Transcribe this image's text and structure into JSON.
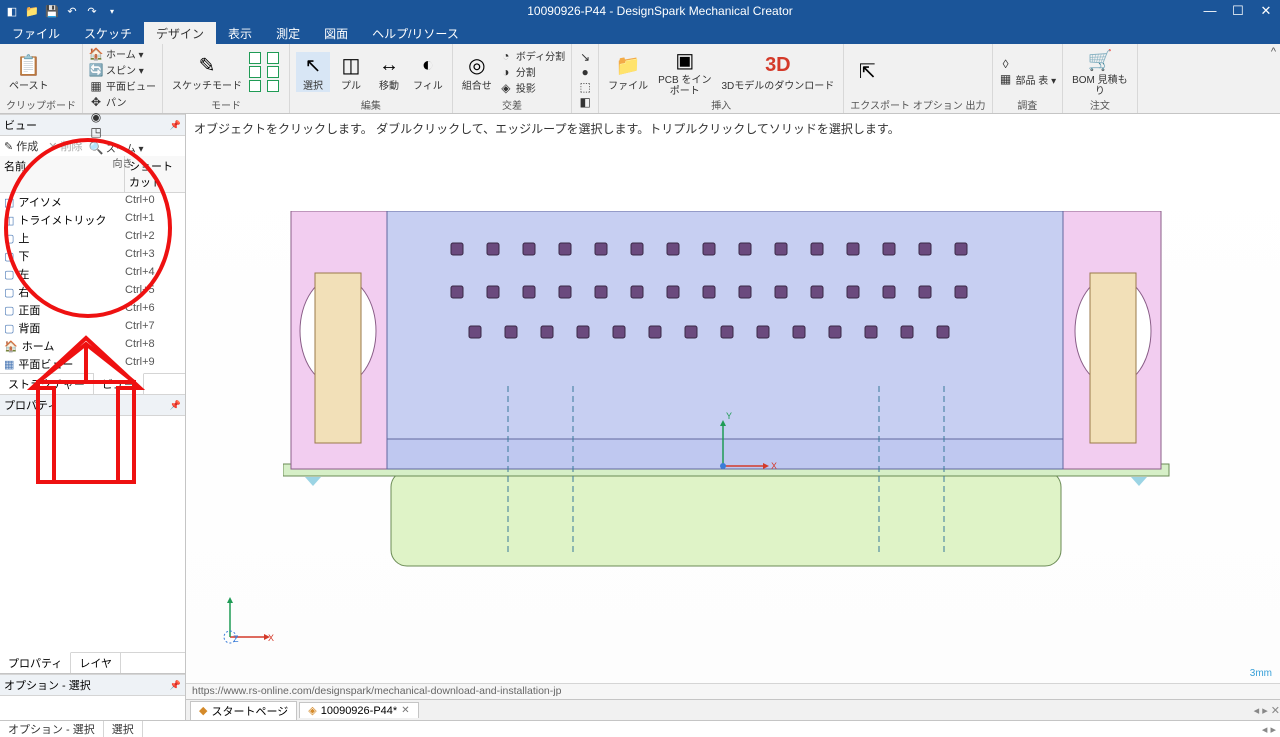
{
  "title": "10090926-P44 - DesignSpark Mechanical Creator",
  "menus": [
    "ファイル",
    "スケッチ",
    "デザイン",
    "表示",
    "測定",
    "図面",
    "ヘルプ/リソース"
  ],
  "active_menu": 2,
  "ribbon": {
    "groups": [
      {
        "label": "クリップボード",
        "big": [
          {
            "l": "ペースト",
            "i": "📋"
          }
        ],
        "small": []
      },
      {
        "label": "向き",
        "big": [],
        "small": [
          [
            "🏠",
            "ホーム ▾"
          ],
          [
            "🔄",
            "スピン ▾"
          ],
          [
            "▦",
            "平面ビュー"
          ],
          [
            "✥",
            "パン"
          ],
          [
            "◉",
            ""
          ],
          [
            "◳",
            ""
          ],
          [
            "🔍",
            "ズーム ▾"
          ]
        ]
      },
      {
        "label": "モード",
        "big": [
          {
            "l": "スケッチモード",
            "i": "✎"
          }
        ],
        "cubes": true
      },
      {
        "label": "編集",
        "big": [
          {
            "l": "選択",
            "i": "↖",
            "sel": true
          },
          {
            "l": "プル",
            "i": "◫"
          },
          {
            "l": "移動",
            "i": "↔"
          },
          {
            "l": "フィル",
            "i": "◐"
          }
        ]
      },
      {
        "label": "交差",
        "big": [
          {
            "l": "組合せ",
            "i": "◎"
          }
        ],
        "small": [
          [
            "◔",
            "ボディ分割"
          ],
          [
            "◑",
            "分割"
          ],
          [
            "◈",
            "投影"
          ]
        ]
      },
      {
        "label": "",
        "big": [],
        "small": [
          [
            "↘",
            ""
          ],
          [
            "●",
            ""
          ],
          [
            "⬚",
            ""
          ],
          [
            "◧",
            ""
          ]
        ],
        "nolabel": true
      },
      {
        "label": "挿入",
        "big": [
          {
            "l": "ファイル",
            "i": "📁"
          },
          {
            "l": "PCB をイン\nポート",
            "i": "▣"
          },
          {
            "l": "3Dモデルのダウンロード",
            "i": "3D",
            "red": true
          }
        ]
      },
      {
        "label": "エクスポート\nオプション\n出力",
        "big": [
          {
            "l": "",
            "i": "⇱"
          }
        ]
      },
      {
        "label": "調査",
        "big": [],
        "small": [
          [
            "◊",
            ""
          ],
          [
            "▦",
            "部品\n表 ▾"
          ]
        ]
      },
      {
        "label": "注文",
        "big": [
          {
            "l": "BOM 見積も\nり",
            "i": "🛒"
          }
        ]
      }
    ]
  },
  "panels": {
    "view_title": "ビュー",
    "create": "作成",
    "delete": "削除",
    "col_name": "名前",
    "col_shortcut": "ショートカット",
    "views": [
      {
        "n": "アイソメ",
        "s": "Ctrl+0",
        "i": "◫"
      },
      {
        "n": "トライメトリック",
        "s": "Ctrl+1",
        "i": "◫"
      },
      {
        "n": "上",
        "s": "Ctrl+2",
        "i": "▢"
      },
      {
        "n": "下",
        "s": "Ctrl+3",
        "i": "▢"
      },
      {
        "n": "左",
        "s": "Ctrl+4",
        "i": "▢"
      },
      {
        "n": "右",
        "s": "Ctrl+5",
        "i": "▢"
      },
      {
        "n": "正面",
        "s": "Ctrl+6",
        "i": "▢"
      },
      {
        "n": "背面",
        "s": "Ctrl+7",
        "i": "▢"
      },
      {
        "n": "ホーム",
        "s": "Ctrl+8",
        "i": "🏠"
      },
      {
        "n": "平面ビュー",
        "s": "Ctrl+9",
        "i": "▦"
      }
    ],
    "tab_structure": "ストラクチャー",
    "tab_view": "ビュー",
    "prop_title": "プロパティ",
    "tab_prop": "プロパティ",
    "tab_layer": "レイヤ",
    "opt_title": "オプション - 選択"
  },
  "hint": "オブジェクトをクリックします。 ダブルクリックして、エッジループを選択します。トリプルクリックしてソリッドを選択します。",
  "url": "https://www.rs-online.com/designspark/mechanical-download-and-installation-jp",
  "zoom": "3mm",
  "doctabs": [
    {
      "l": "スタートページ",
      "i": "◆"
    },
    {
      "l": "10090926-P44*",
      "i": "◈",
      "active": true
    }
  ],
  "status": {
    "left": "オプション - 選択",
    "sel": "選択"
  }
}
